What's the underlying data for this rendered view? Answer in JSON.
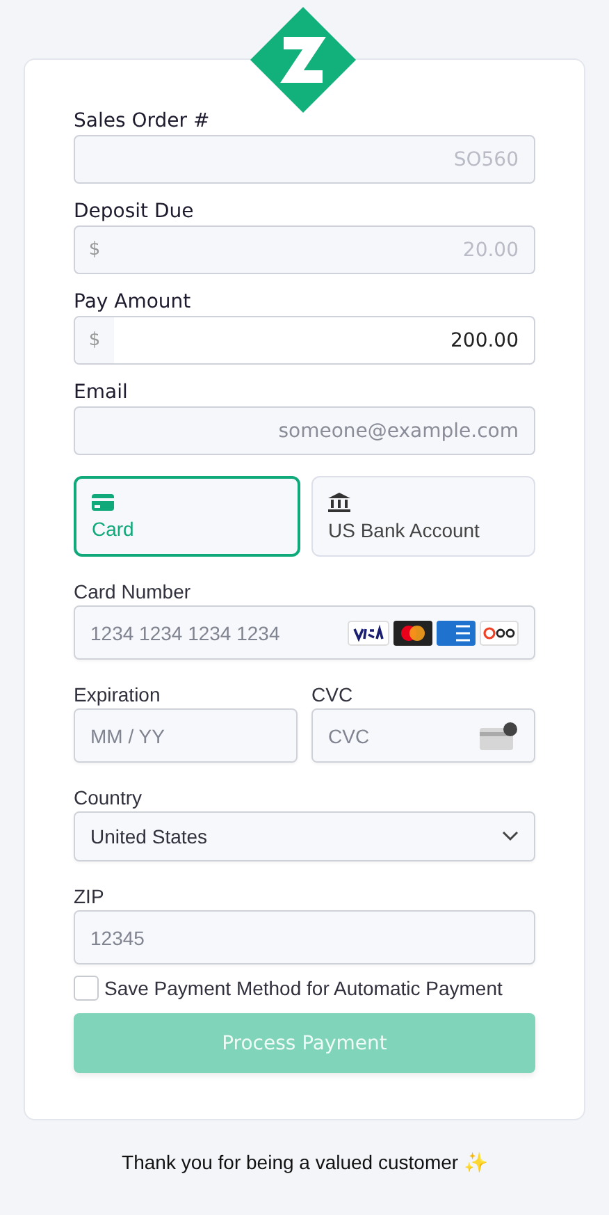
{
  "form": {
    "sales_order": {
      "label": "Sales Order #",
      "value": "SO560",
      "disabled": true
    },
    "deposit_due": {
      "label": "Deposit Due",
      "currency": "$",
      "value": "20.00",
      "disabled": true
    },
    "pay_amount": {
      "label": "Pay Amount",
      "currency": "$",
      "value": "200.00",
      "disabled": false
    },
    "email": {
      "label": "Email",
      "placeholder": "someone@example.com"
    }
  },
  "payment_methods": [
    {
      "kind": "card",
      "label": "Card",
      "selected": true
    },
    {
      "kind": "bank",
      "label": "US Bank Account",
      "selected": false
    }
  ],
  "card": {
    "number_label": "Card Number",
    "number_placeholder": "1234 1234 1234 1234",
    "expiration_label": "Expiration",
    "expiration_placeholder": "MM / YY",
    "cvc_label": "CVC",
    "cvc_placeholder": "CVC",
    "country_label": "Country",
    "country_value": "United States",
    "zip_label": "ZIP",
    "zip_placeholder": "12345"
  },
  "save_method": {
    "label": "Save Payment Method for Automatic Payment",
    "checked": false
  },
  "submit": {
    "label": "Process Payment",
    "disabled": true
  },
  "footer": {
    "text": "Thank you for being a valued customer ✨"
  }
}
